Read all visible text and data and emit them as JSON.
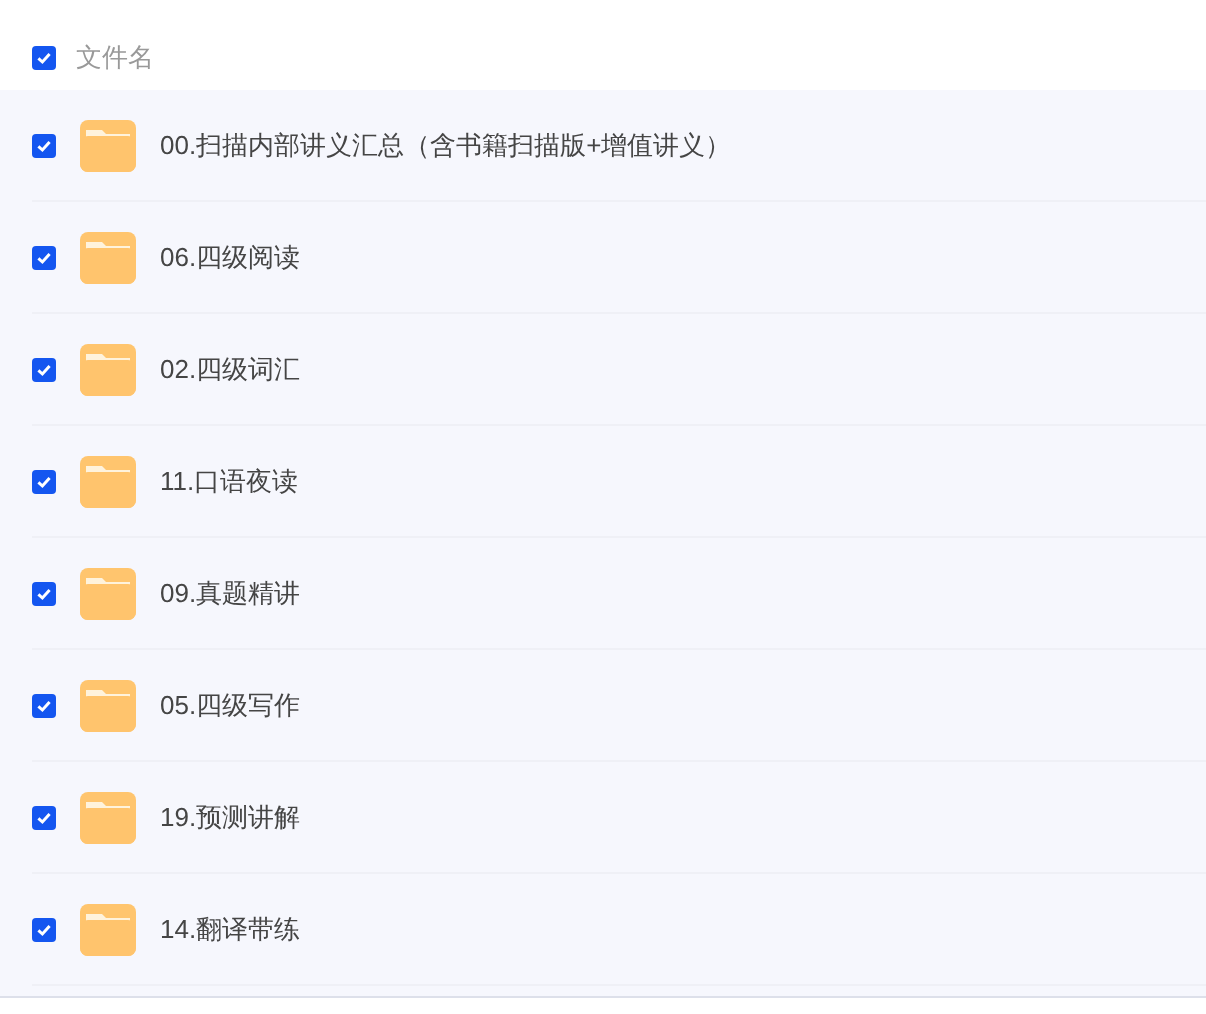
{
  "header": {
    "label": "文件名",
    "checked": true
  },
  "files": [
    {
      "name": "00.扫描内部讲义汇总（含书籍扫描版+增值讲义）",
      "checked": true
    },
    {
      "name": "06.四级阅读",
      "checked": true
    },
    {
      "name": "02.四级词汇",
      "checked": true
    },
    {
      "name": "11.口语夜读",
      "checked": true
    },
    {
      "name": "09.真题精讲",
      "checked": true
    },
    {
      "name": "05.四级写作",
      "checked": true
    },
    {
      "name": "19.预测讲解",
      "checked": true
    },
    {
      "name": "14.翻译带练",
      "checked": true
    }
  ]
}
